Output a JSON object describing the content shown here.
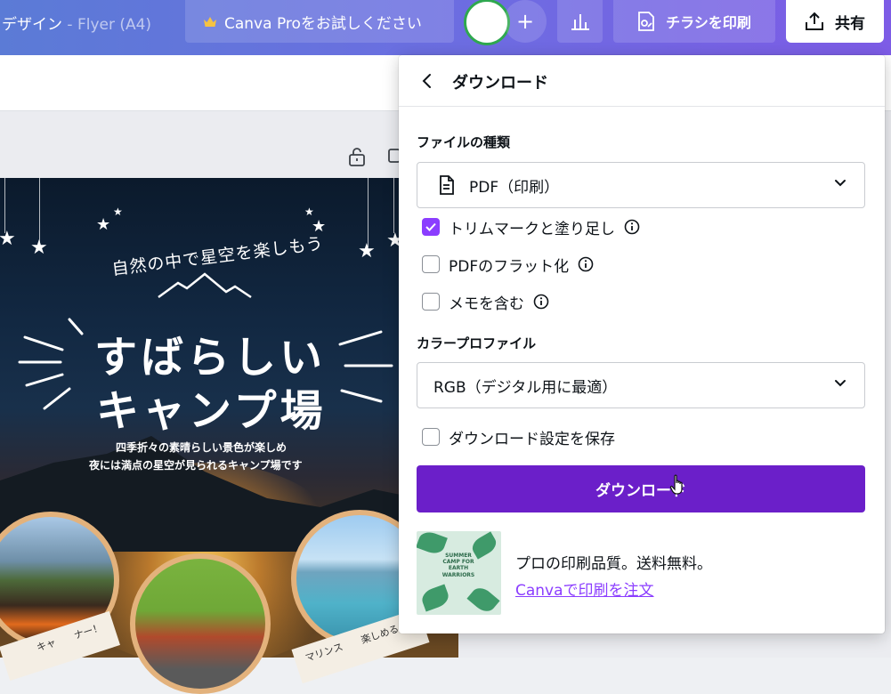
{
  "topbar": {
    "doc_title": "デザイン",
    "doc_subtitle": " - Flyer (A4)",
    "pro_label": "Canva Proをお試しください",
    "print_label": "チラシを印刷",
    "share_label": "共有"
  },
  "flyer": {
    "tagline": "自然の中で星空を楽しもう",
    "headline1": "すばらしい",
    "headline2": "キャンプ場",
    "desc1": "四季折々の素晴らしい景色が楽しめ",
    "desc2": "夜には満点の星空が見られるキャンプ場です",
    "ribbon1": "キャ　　ナー！",
    "ribbon3": "マリンス　　楽しめる"
  },
  "panel": {
    "title": "ダウンロード",
    "file_type_label": "ファイルの種類",
    "file_type_value": "PDF（印刷）",
    "options": [
      {
        "label": "トリムマークと塗り足し",
        "checked": true
      },
      {
        "label": "PDFのフラット化",
        "checked": false
      },
      {
        "label": "メモを含む",
        "checked": false
      }
    ],
    "color_profile_label": "カラープロファイル",
    "color_profile_value": "RGB（デジタル用に最適）",
    "save_settings_label": "ダウンロード設定を保存",
    "download_button": "ダウンロード",
    "promo_text": "プロの印刷品質。送料無料。",
    "promo_link": "Canvaで印刷を注文",
    "thumb_title": "SUMMER CAMP FOR EARTH WARRIORS"
  },
  "colors": {
    "accent": "#8b3dff",
    "download_button": "#6b1fc9",
    "topbar_start": "#5b7bd6",
    "topbar_end": "#7d5ce6"
  }
}
